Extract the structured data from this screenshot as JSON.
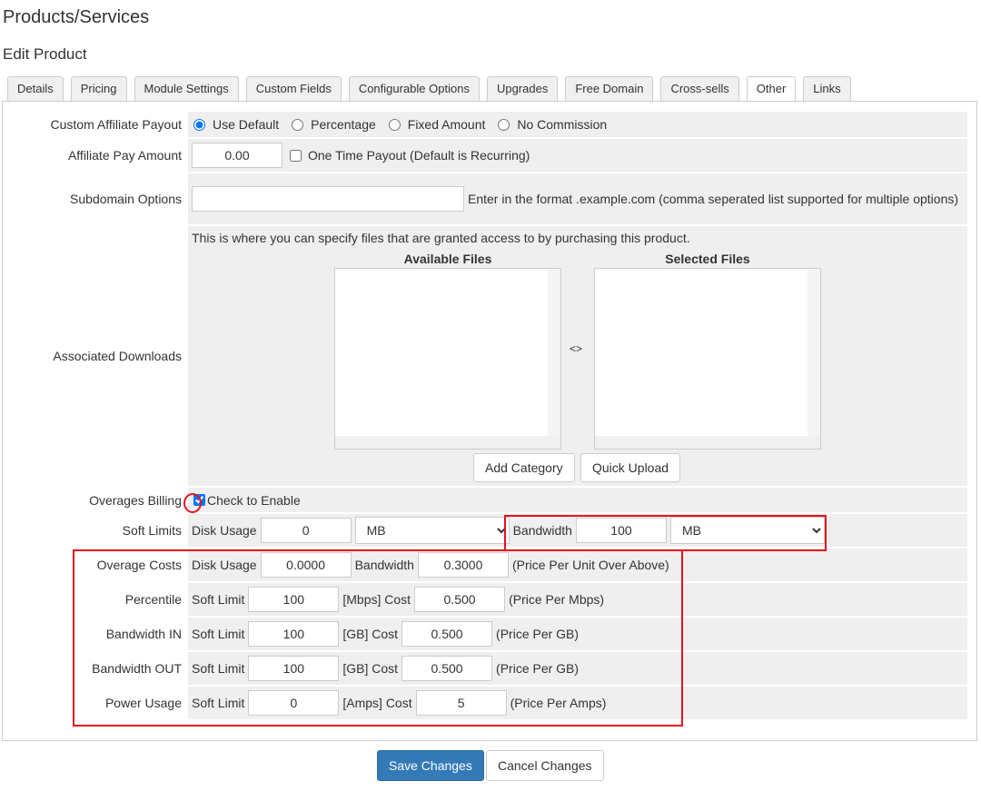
{
  "header": {
    "title": "Products/Services",
    "subtitle": "Edit Product"
  },
  "tabs": [
    "Details",
    "Pricing",
    "Module Settings",
    "Custom Fields",
    "Configurable Options",
    "Upgrades",
    "Free Domain",
    "Cross-sells",
    "Other",
    "Links"
  ],
  "active_tab": "Other",
  "affiliate": {
    "label": "Custom Affiliate Payout",
    "options": [
      "Use Default",
      "Percentage",
      "Fixed Amount",
      "No Commission"
    ],
    "selected": "Use Default"
  },
  "pay_amount": {
    "label": "Affiliate Pay Amount",
    "value": "0.00",
    "one_time": "One Time Payout (Default is Recurring)"
  },
  "subdomain": {
    "label": "Subdomain Options",
    "value": "",
    "help": "Enter in the format .example.com (comma seperated list supported for multiple options)"
  },
  "downloads": {
    "label": "Associated Downloads",
    "help": "This is where you can specify files that are granted access to by purchasing this product.",
    "available": "Available Files",
    "selected": "Selected Files",
    "swap": "<>",
    "add_category": "Add Category",
    "quick_upload": "Quick Upload"
  },
  "overages": {
    "label": "Overages Billing",
    "check": "Check to Enable",
    "checked": true
  },
  "soft_limits": {
    "label": "Soft Limits",
    "disk_label": "Disk Usage",
    "disk": "0",
    "disk_unit": "MB",
    "bw_label": "Bandwidth",
    "bw": "100",
    "bw_unit": "MB"
  },
  "overage_costs": {
    "label": "Overage Costs",
    "disk_label": "Disk Usage",
    "disk": "0.0000",
    "bw_label": "Bandwidth",
    "bw": "0.3000",
    "note": "(Price Per Unit Over Above)"
  },
  "rows": [
    {
      "label": "Percentile",
      "sl": "Soft Limit",
      "limit": "100",
      "unit": "[Mbps] Cost",
      "cost": "0.500",
      "note": "(Price Per Mbps)"
    },
    {
      "label": "Bandwidth IN",
      "sl": "Soft Limit",
      "limit": "100",
      "unit": "[GB] Cost",
      "cost": "0.500",
      "note": "(Price Per GB)"
    },
    {
      "label": "Bandwidth OUT",
      "sl": "Soft Limit",
      "limit": "100",
      "unit": "[GB] Cost",
      "cost": "0.500",
      "note": "(Price Per GB)"
    },
    {
      "label": "Power Usage",
      "sl": "Soft Limit",
      "limit": "0",
      "unit": "[Amps] Cost",
      "cost": "5",
      "note": "(Price Per Amps)"
    }
  ],
  "actions": {
    "save": "Save Changes",
    "cancel": "Cancel Changes"
  },
  "colors": {
    "primary": "#337ab7",
    "highlight": "#e5121f"
  }
}
